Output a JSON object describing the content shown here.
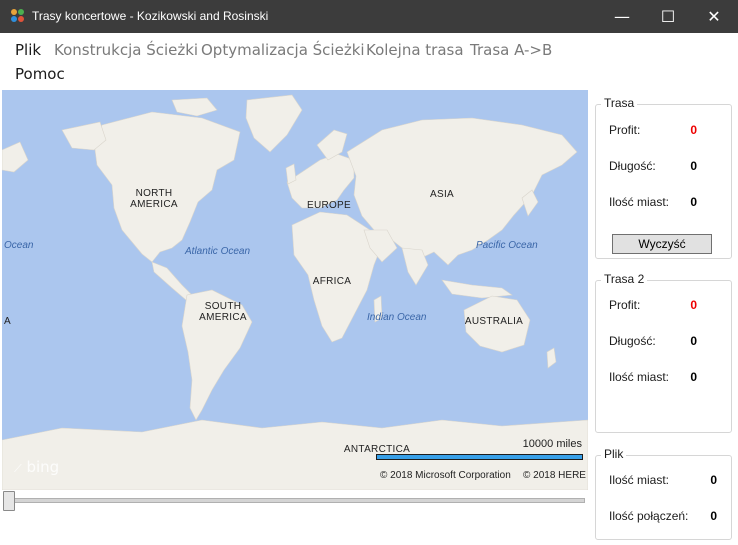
{
  "window": {
    "title": "Trasy koncertowe - Kozikowski and Rosinski",
    "controls": {
      "minimize": "—",
      "maximize": "☐",
      "close": "✕"
    }
  },
  "menu": [
    {
      "label": "Plik",
      "active": true
    },
    {
      "label": "Konstrukcja Ścieżki",
      "active": false
    },
    {
      "label": "Optymalizacja Ścieżki",
      "active": false
    },
    {
      "label": "Kolejna trasa",
      "active": false
    },
    {
      "label": "Trasa A->B",
      "active": false
    },
    {
      "label": "Pomoc",
      "active": true
    }
  ],
  "map": {
    "continents": [
      "NORTH AMERICA",
      "SOUTH AMERICA",
      "EUROPE",
      "ASIA",
      "AFRICA",
      "AUSTRALIA",
      "ANTARCTICA"
    ],
    "oceans": [
      "Atlantic Ocean",
      "Pacific Ocean",
      "Indian Ocean",
      "Ocean",
      "A"
    ],
    "scale": "10000 miles",
    "copyright_microsoft": "© 2018 Microsoft Corporation",
    "copyright_here": "© 2018 HERE",
    "logo": "bing",
    "colors": {
      "water": "#abc6ee",
      "land": "#f1efe9",
      "scale_bar": "#38a0e8"
    }
  },
  "panels": {
    "trasa": {
      "title": "Trasa",
      "profit_label": "Profit:",
      "profit_value": "0",
      "length_label": "Długość:",
      "length_value": "0",
      "cities_label": "Ilość miast:",
      "cities_value": "0",
      "clear_button": "Wyczyść"
    },
    "trasa2": {
      "title": "Trasa 2",
      "profit_label": "Profit:",
      "profit_value": "0",
      "length_label": "Długość:",
      "length_value": "0",
      "cities_label": "Ilość miast:",
      "cities_value": "0"
    },
    "plik": {
      "title": "Plik",
      "cities_label": "Ilość miast:",
      "cities_value": "0",
      "connections_label": "Ilość połączeń:",
      "connections_value": "0"
    }
  },
  "colors": {
    "titlebar": "#3c3c3c",
    "profit": "#ee0000"
  }
}
